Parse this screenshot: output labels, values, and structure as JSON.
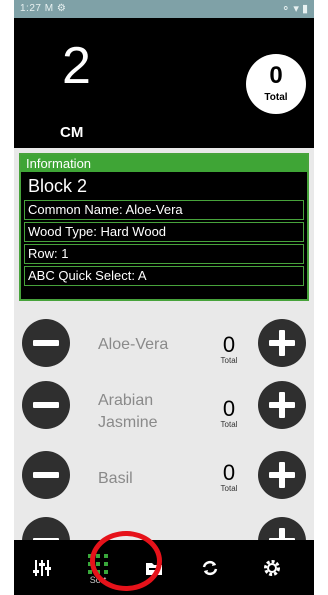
{
  "status_bar": {
    "time": "1:27",
    "extra": "M",
    "right_icons": "⚬ ▾ ▮"
  },
  "header": {
    "count": "2",
    "unit": "CM",
    "total_value": "0",
    "total_label": "Total"
  },
  "info": {
    "header": "Information",
    "block": "Block 2",
    "common_name": "Common Name: Aloe-Vera",
    "wood_type": "Wood Type: Hard Wood",
    "row": "Row: 1",
    "abc_quick": "ABC Quick Select: A"
  },
  "items": [
    {
      "name": "Aloe-Vera",
      "count": "0",
      "total_label": "Total"
    },
    {
      "name": "Arabian Jasmine",
      "count": "0",
      "total_label": "Total"
    },
    {
      "name": "Basil",
      "count": "0",
      "total_label": "Total"
    }
  ],
  "nav": {
    "items": [
      {
        "icon": "sliders-icon"
      },
      {
        "icon": "sort-grid-icon",
        "label": "Sort"
      },
      {
        "icon": "folder-icon"
      },
      {
        "icon": "sync-icon"
      },
      {
        "icon": "gear-icon"
      }
    ]
  },
  "colors": {
    "accent_green": "#3fa536",
    "highlight_red": "#e6121a",
    "header_bg": "#000000"
  }
}
